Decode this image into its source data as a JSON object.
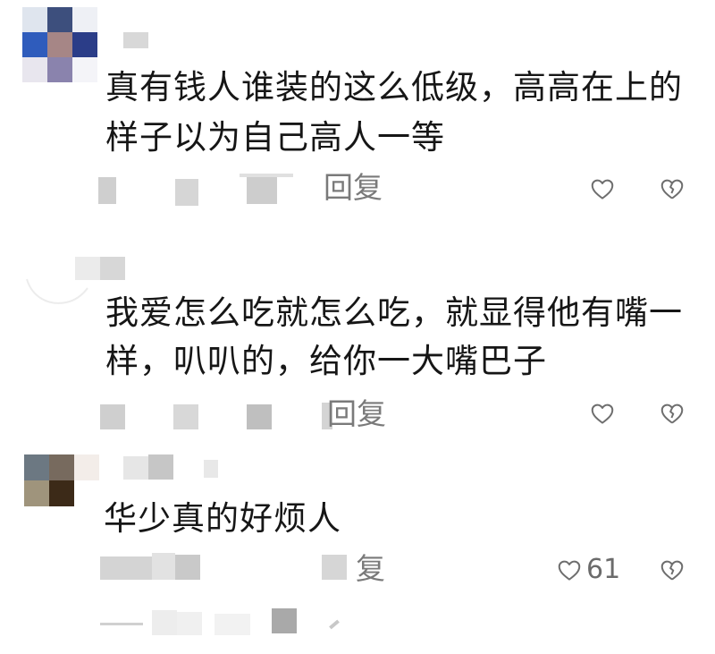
{
  "comments": [
    {
      "text_line1": "真有钱人谁装的这么低级，高高在上的",
      "text_line2": "样子以为自己高人一等",
      "reply_label": "回复"
    },
    {
      "text_line1": "我爱怎么吃就怎么吃，就显得他有嘴一",
      "text_line2": "样，叭叭的，给你一大嘴巴子",
      "reply_label": "回复"
    },
    {
      "text_line1": "华少真的好烦人",
      "reply_label": "复",
      "like_count": "61"
    }
  ],
  "icons": {
    "like": "heart-outline-icon",
    "dislike": "broken-heart-outline-icon"
  },
  "colors": {
    "text": "#161616",
    "meta": "#7a7a7a",
    "blur": "#cfcfcf"
  }
}
